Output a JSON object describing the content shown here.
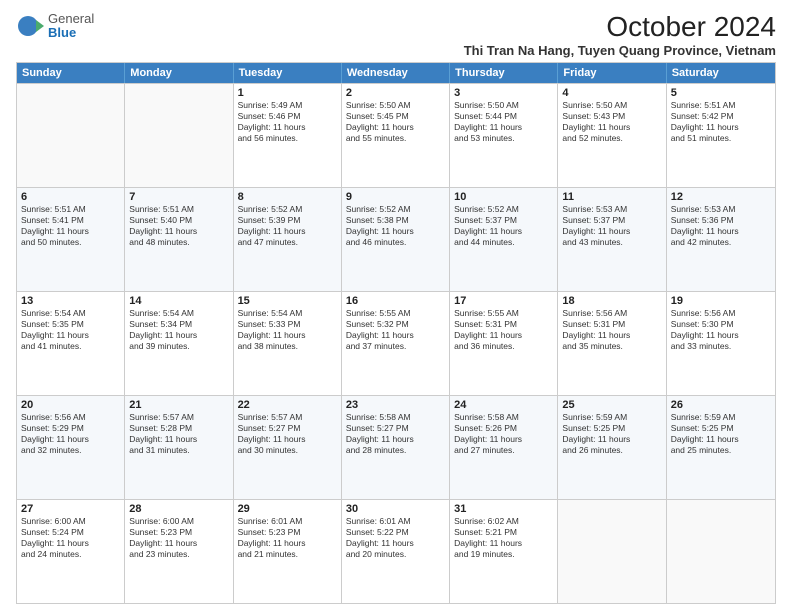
{
  "logo": {
    "general": "General",
    "blue": "Blue"
  },
  "title": "October 2024",
  "subtitle": "Thi Tran Na Hang, Tuyen Quang Province, Vietnam",
  "header_days": [
    "Sunday",
    "Monday",
    "Tuesday",
    "Wednesday",
    "Thursday",
    "Friday",
    "Saturday"
  ],
  "weeks": [
    [
      {
        "day": "",
        "sunrise": "",
        "sunset": "",
        "daylight": "",
        "empty": true
      },
      {
        "day": "",
        "sunrise": "",
        "sunset": "",
        "daylight": "",
        "empty": true
      },
      {
        "day": "1",
        "info": "Sunrise: 5:49 AM\nSunset: 5:46 PM\nDaylight: 11 hours\nand 56 minutes."
      },
      {
        "day": "2",
        "info": "Sunrise: 5:50 AM\nSunset: 5:45 PM\nDaylight: 11 hours\nand 55 minutes."
      },
      {
        "day": "3",
        "info": "Sunrise: 5:50 AM\nSunset: 5:44 PM\nDaylight: 11 hours\nand 53 minutes."
      },
      {
        "day": "4",
        "info": "Sunrise: 5:50 AM\nSunset: 5:43 PM\nDaylight: 11 hours\nand 52 minutes."
      },
      {
        "day": "5",
        "info": "Sunrise: 5:51 AM\nSunset: 5:42 PM\nDaylight: 11 hours\nand 51 minutes."
      }
    ],
    [
      {
        "day": "6",
        "info": "Sunrise: 5:51 AM\nSunset: 5:41 PM\nDaylight: 11 hours\nand 50 minutes."
      },
      {
        "day": "7",
        "info": "Sunrise: 5:51 AM\nSunset: 5:40 PM\nDaylight: 11 hours\nand 48 minutes."
      },
      {
        "day": "8",
        "info": "Sunrise: 5:52 AM\nSunset: 5:39 PM\nDaylight: 11 hours\nand 47 minutes."
      },
      {
        "day": "9",
        "info": "Sunrise: 5:52 AM\nSunset: 5:38 PM\nDaylight: 11 hours\nand 46 minutes."
      },
      {
        "day": "10",
        "info": "Sunrise: 5:52 AM\nSunset: 5:37 PM\nDaylight: 11 hours\nand 44 minutes."
      },
      {
        "day": "11",
        "info": "Sunrise: 5:53 AM\nSunset: 5:37 PM\nDaylight: 11 hours\nand 43 minutes."
      },
      {
        "day": "12",
        "info": "Sunrise: 5:53 AM\nSunset: 5:36 PM\nDaylight: 11 hours\nand 42 minutes."
      }
    ],
    [
      {
        "day": "13",
        "info": "Sunrise: 5:54 AM\nSunset: 5:35 PM\nDaylight: 11 hours\nand 41 minutes."
      },
      {
        "day": "14",
        "info": "Sunrise: 5:54 AM\nSunset: 5:34 PM\nDaylight: 11 hours\nand 39 minutes."
      },
      {
        "day": "15",
        "info": "Sunrise: 5:54 AM\nSunset: 5:33 PM\nDaylight: 11 hours\nand 38 minutes."
      },
      {
        "day": "16",
        "info": "Sunrise: 5:55 AM\nSunset: 5:32 PM\nDaylight: 11 hours\nand 37 minutes."
      },
      {
        "day": "17",
        "info": "Sunrise: 5:55 AM\nSunset: 5:31 PM\nDaylight: 11 hours\nand 36 minutes."
      },
      {
        "day": "18",
        "info": "Sunrise: 5:56 AM\nSunset: 5:31 PM\nDaylight: 11 hours\nand 35 minutes."
      },
      {
        "day": "19",
        "info": "Sunrise: 5:56 AM\nSunset: 5:30 PM\nDaylight: 11 hours\nand 33 minutes."
      }
    ],
    [
      {
        "day": "20",
        "info": "Sunrise: 5:56 AM\nSunset: 5:29 PM\nDaylight: 11 hours\nand 32 minutes."
      },
      {
        "day": "21",
        "info": "Sunrise: 5:57 AM\nSunset: 5:28 PM\nDaylight: 11 hours\nand 31 minutes."
      },
      {
        "day": "22",
        "info": "Sunrise: 5:57 AM\nSunset: 5:27 PM\nDaylight: 11 hours\nand 30 minutes."
      },
      {
        "day": "23",
        "info": "Sunrise: 5:58 AM\nSunset: 5:27 PM\nDaylight: 11 hours\nand 28 minutes."
      },
      {
        "day": "24",
        "info": "Sunrise: 5:58 AM\nSunset: 5:26 PM\nDaylight: 11 hours\nand 27 minutes."
      },
      {
        "day": "25",
        "info": "Sunrise: 5:59 AM\nSunset: 5:25 PM\nDaylight: 11 hours\nand 26 minutes."
      },
      {
        "day": "26",
        "info": "Sunrise: 5:59 AM\nSunset: 5:25 PM\nDaylight: 11 hours\nand 25 minutes."
      }
    ],
    [
      {
        "day": "27",
        "info": "Sunrise: 6:00 AM\nSunset: 5:24 PM\nDaylight: 11 hours\nand 24 minutes."
      },
      {
        "day": "28",
        "info": "Sunrise: 6:00 AM\nSunset: 5:23 PM\nDaylight: 11 hours\nand 23 minutes."
      },
      {
        "day": "29",
        "info": "Sunrise: 6:01 AM\nSunset: 5:23 PM\nDaylight: 11 hours\nand 21 minutes."
      },
      {
        "day": "30",
        "info": "Sunrise: 6:01 AM\nSunset: 5:22 PM\nDaylight: 11 hours\nand 20 minutes."
      },
      {
        "day": "31",
        "info": "Sunrise: 6:02 AM\nSunset: 5:21 PM\nDaylight: 11 hours\nand 19 minutes."
      },
      {
        "day": "",
        "info": "",
        "empty": true
      },
      {
        "day": "",
        "info": "",
        "empty": true
      }
    ]
  ]
}
